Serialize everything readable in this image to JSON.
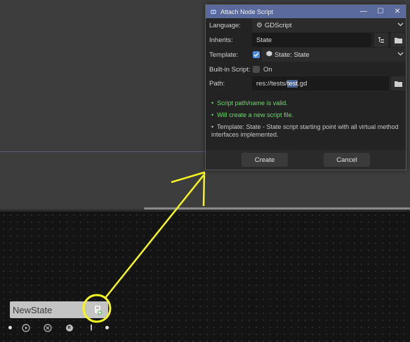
{
  "dialog": {
    "title": "Attach Node Script",
    "language": {
      "label": "Language:",
      "value": "GDScript"
    },
    "inherits": {
      "label": "Inherits:",
      "value": "State"
    },
    "template": {
      "label": "Template:",
      "checked": true,
      "value": "State: State"
    },
    "builtin": {
      "label": "Built-in Script:",
      "checked": false,
      "value": "On"
    },
    "path": {
      "label": "Path:",
      "value_prefix": "res://tests/",
      "value_selected": "test",
      "value_suffix": ".gd"
    },
    "messages": [
      {
        "text": "Script path/name is valid.",
        "kind": "ok"
      },
      {
        "text": "Will create a new script file.",
        "kind": "ok"
      },
      {
        "text": "Template: State - State script starting point with all virtual method interfaces implemented.",
        "kind": "info"
      }
    ],
    "create_label": "Create",
    "cancel_label": "Cancel"
  },
  "graph": {
    "node_title": "NewState"
  },
  "colors": {
    "titlebar": "#5b6a9c",
    "valid_text": "#6fd86f",
    "annotation": "#f5f51f",
    "checkbox_on": "#4a8ad8"
  }
}
